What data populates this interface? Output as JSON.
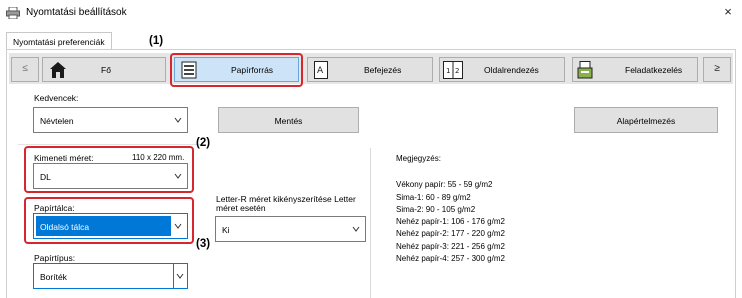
{
  "window": {
    "title": "Nyomtatási beállítások",
    "close_glyph": "×"
  },
  "tab": {
    "label": "Nyomtatási preferenciák"
  },
  "toolbar": {
    "prev_glyph": "≤",
    "next_glyph": "≥",
    "items": [
      {
        "label": "Fő",
        "icon": "home-icon"
      },
      {
        "label": "Papírforrás",
        "icon": "paper-tray-icon",
        "active": true
      },
      {
        "label": "Befejezés",
        "icon": "finishing-icon"
      },
      {
        "label": "Oldalrendezés",
        "icon": "layout-icon"
      },
      {
        "label": "Feladatkezelés",
        "icon": "job-handling-icon"
      }
    ]
  },
  "favorites": {
    "label": "Kedvencek:",
    "value": "Névtelen",
    "save_label": "Mentés",
    "default_label": "Alapértelmezés"
  },
  "output_size": {
    "label": "Kimeneti méret:",
    "dimension": "110 x 220 mm.",
    "value": "DL"
  },
  "paper_tray": {
    "label": "Papírtálca:",
    "value": "Oldalsó tálca"
  },
  "paper_type": {
    "label": "Papírtípus:",
    "value": "Boríték"
  },
  "letter_r": {
    "label_line1": "Letter-R méret kikényszerítése Letter",
    "label_line2": "méret esetén",
    "value": "Ki"
  },
  "notes": {
    "heading": "Megjegyzés:",
    "lines": [
      "Vékony papír: 55 - 59 g/m2",
      "Sima-1: 60 - 89 g/m2",
      "Sima-2: 90 - 105 g/m2",
      "Nehéz papír-1: 106 - 176 g/m2",
      "Nehéz papír-2: 177 - 220 g/m2",
      "Nehéz papír-3: 221 - 256 g/m2",
      "Nehéz papír-4: 257 - 300 g/m2"
    ]
  },
  "annotations": {
    "a1": "(1)",
    "a2": "(2)",
    "a3": "(3)"
  },
  "colors": {
    "highlight_red": "#d6262e",
    "accent_blue": "#0078d7",
    "active_tab_bg": "#cde3f7"
  }
}
